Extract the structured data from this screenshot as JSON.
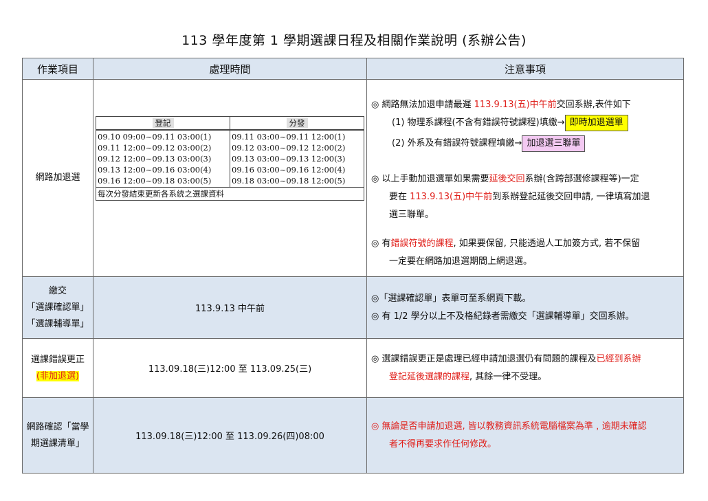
{
  "title": "113 學年度第 1 學期選課日程及相關作業說明 (系辦公告)",
  "headers": [
    "作業項目",
    "處理時間",
    "注意事項"
  ],
  "row1": {
    "item": "網路加退選",
    "schedule": {
      "col1_header": "登記",
      "col2_header": "分發",
      "col1_lines": [
        "09.10 09:00~09.11 03:00(1)",
        "09.11 12:00~09.12 03:00(2)",
        "09.12 12:00~09.13 03:00(3)",
        "09.13 12:00~09.16 03:00(4)",
        "09.16 12:00~09.18 03:00(5)"
      ],
      "col2_lines": [
        "09.11 03:00~09.11 12:00(1)",
        "09.12 03:00~09.12 12:00(2)",
        "09.13 03:00~09.13 12:00(3)",
        "09.16 03:00~09.16 12:00(4)",
        "09.18 03:00~09.18 12:00(5)"
      ],
      "footer": "每次分發結束更新各系統之選課資料"
    },
    "notes": {
      "n1_pre": "◎  網路無法加退申請最遲 ",
      "n1_red": "113.9.13(五)中午前",
      "n1_post": "交回系辦,表件如下",
      "n1a": "(1)  物理系課程(不含有錯誤符號課程)填繳→",
      "n1a_box": "即時加退選單",
      "n1b": "(2)  外系及有錯誤符號課程填繳→",
      "n1b_box": "加退選三聯單",
      "n2_pre": "◎  以上手動加退選單如果需要",
      "n2_red": "延後交回",
      "n2_post": "系辦(含跨部選修課程等)一定",
      "n2_l2_pre": "要在 ",
      "n2_l2_red": "113.9.13(五)中午前",
      "n2_l2_post": "到系辦登記延後交回申請, 一律填寫加退",
      "n2_l3": "選三聯單。",
      "n3_pre": "◎   有",
      "n3_red": "錯誤符號的課程",
      "n3_post": ", 如果要保留, 只能透過人工加簽方式, 若不保留",
      "n3_l2": "一定要在網路加退選期間上網退選。"
    }
  },
  "row2": {
    "item_l1": "繳交",
    "item_l2": "「選課確認單」",
    "item_l3": "「選課輔導單」",
    "time": "113.9.13 中午前",
    "note1": "◎「選課確認單」表單可至系網頁下載。",
    "note2": "◎  有 1/2 學分以上不及格紀錄者需繳交「選課輔導單」交回系辦。"
  },
  "row3": {
    "item_l1": "選課錯誤更正",
    "item_l2": "(非加退選)",
    "time": "113.09.18(三)12:00 至 113.09.25(三)",
    "note_pre": "◎  選課錯誤更正是處理已經申請加退選仍有問題的課程及",
    "note_red1": "已經到系辦",
    "note_red2": "登記延後選課的課程",
    "note_post": ", 其餘一律不受理。"
  },
  "row4": {
    "item_l1": "網路確認「當學",
    "item_l2": "期選課清單」",
    "time": "113.09.18(三)12:00 至 113.09.26(四)08:00",
    "note_l1": "◎  無論是否申請加退選, 皆以教務資訊系統電腦檔案為準﹐逾期未確認",
    "note_l2": "者不得再要求作任何修改。"
  },
  "colors": {
    "header_bg": "#dbe5f1",
    "red": "#e0201b",
    "yellow": "#ffff00",
    "pink": "#f3c9f2"
  }
}
